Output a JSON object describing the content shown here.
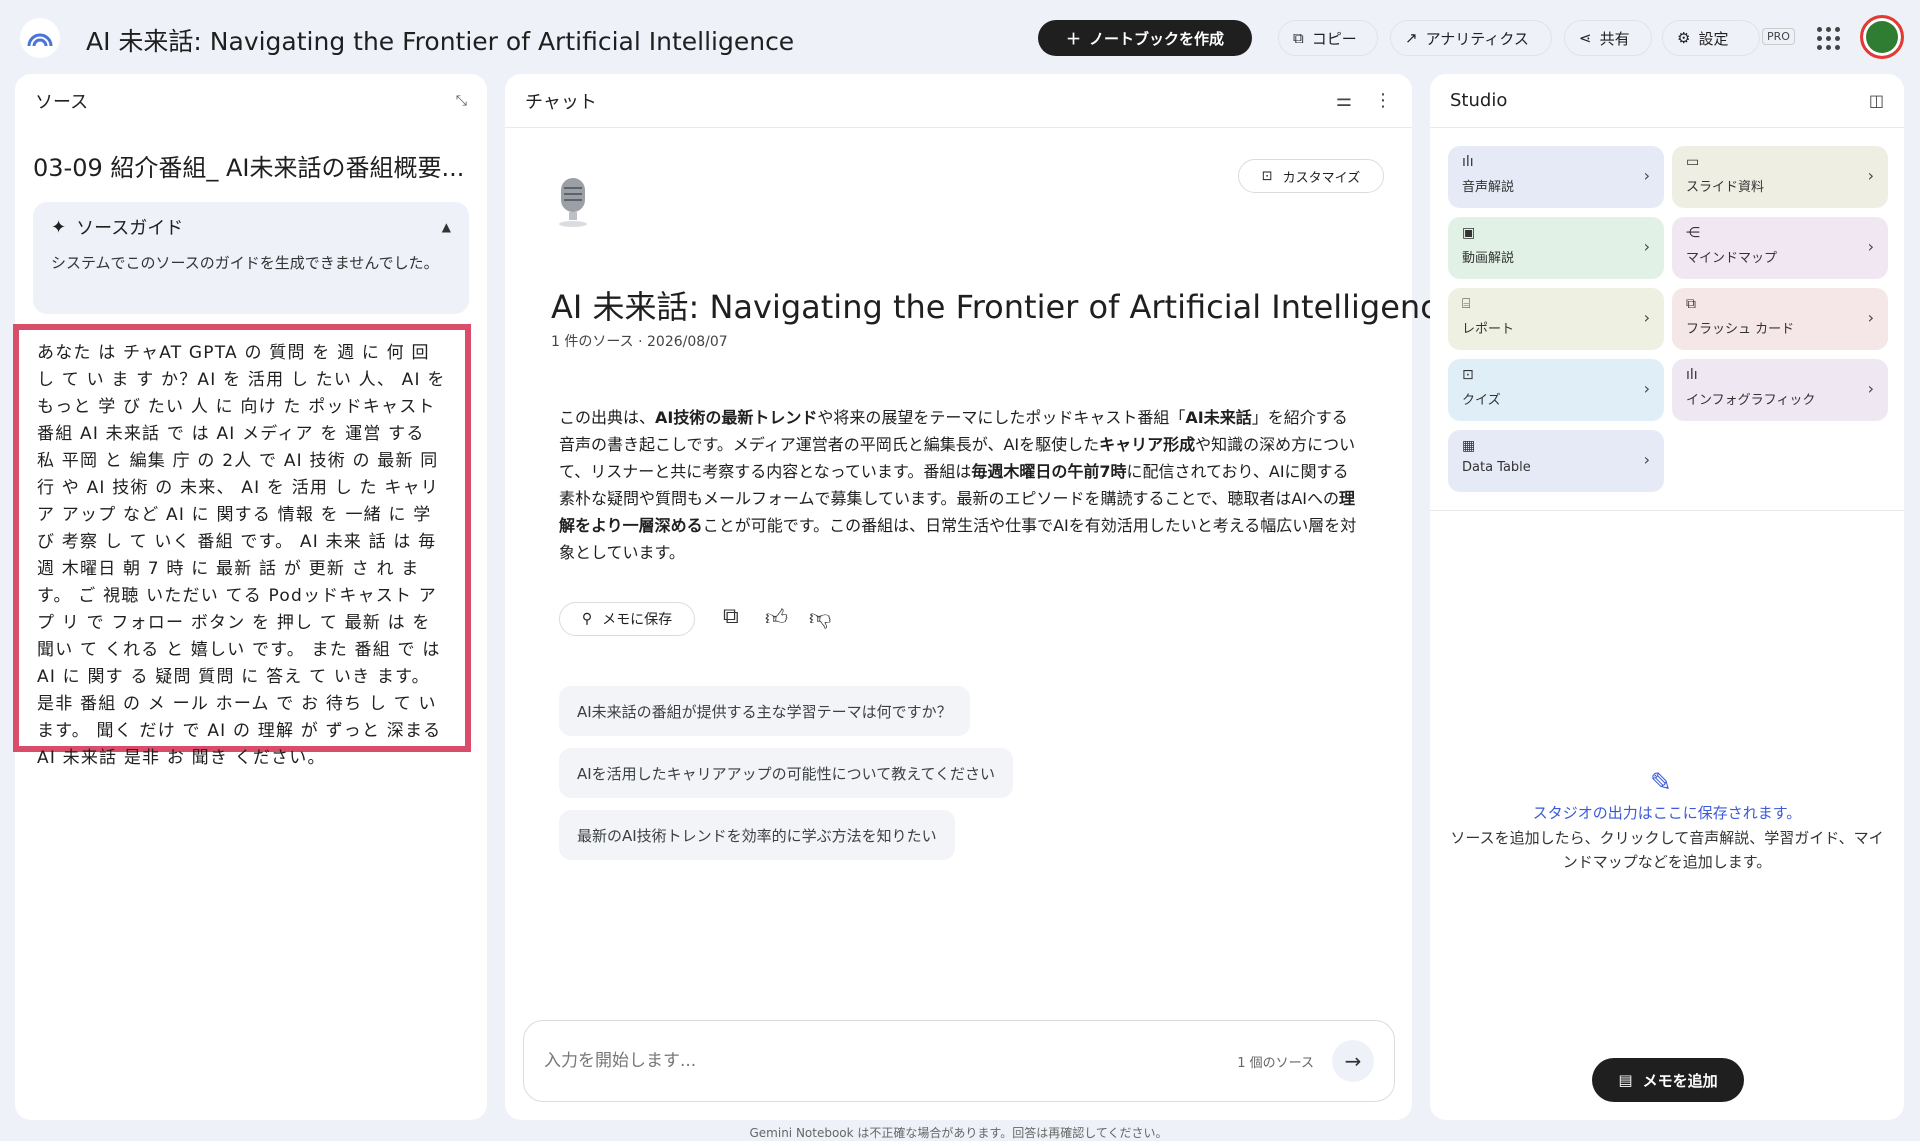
{
  "header": {
    "title": "AI 未来話: Navigating the Frontier of Artificial Intelligence",
    "create_label": "ノートブックを作成",
    "copy_label": "コピー",
    "analytics_label": "アナリティクス",
    "share_label": "共有",
    "settings_label": "設定",
    "pro_label": "PRO"
  },
  "sources": {
    "panel_title": "ソース",
    "source_title": "03-09 紹介番組_ AI未来話の番組概要...",
    "guide_title": "ソースガイド",
    "guide_text": "システムでこのソースのガイドを生成できませんでした。",
    "transcript": "あなた は チャAT GPTA の 質問 を 週 に 何 回 し て い ま す か？AI を 活用 し たい 人、 AI を もっと 学 び たい 人 に 向け た ポッドキャスト 番組 AI 未来話 で は AI メディア を 運営 する 私 平岡 と 編集 庁 の 2人 で AI 技術 の 最新 同行 や AI 技術 の 未来、 AI を 活用 し た キャリア アップ など AI に 関する 情報 を 一緒 に 学び 考察 し て いく 番組 です。 AI 未来 話 は 毎週 木曜日 朝 7 時 に 最新 話 が 更新 さ れ ま す。 ご 視聴 いただい てる Podッドキャスト アプ リ で フォロー ボタン を 押し て 最新 は を 聞い て くれる と 嬉しい です。 また 番組 で は AI に 関す る 疑問 質問 に 答え て いき ます。 是非 番組 の メ ール ホーム で お 待ち し て い ます。 聞く だけ で AI の 理解 が ずっと 深まる AI 未来話 是非 お 聞き ください。"
  },
  "chat": {
    "panel_title": "チャット",
    "customize_label": "カスタマイズ",
    "notebook_title": "AI 未来話: Navigating the Frontier of Artificial Intelligence",
    "meta": "1 件のソース · 2026/08/07",
    "summary": {
      "p1": "この出典は、",
      "b1": "AI技術の最新トレンド",
      "p2": "や将来の展望をテーマにしたポッドキャスト番組「",
      "b2": "AI未来話",
      "p3": "」を紹介する音声の書き起こしです。メディア運営者の平岡氏と編集長が、AIを駆使した",
      "b3": "キャリア形成",
      "p4": "や知識の深め方について、リスナーと共に考察する内容となっています。番組は",
      "b4": "毎週木曜日の午前7時",
      "p5": "に配信されており、AIに関する素朴な疑問や質問もメールフォームで募集しています。最新のエピソードを購読することで、聴取者はAIへの",
      "b5": "理解をより一層深める",
      "p6": "ことが可能です。この番組は、日常生活や仕事でAIを有効活用したいと考える幅広い層を対象としています。"
    },
    "save_memo_label": "メモに保存",
    "suggestions": [
      "AI未来話の番組が提供する主な学習テーマは何ですか？",
      "AIを活用したキャリアアップの可能性について教えてください",
      "最新のAI技術トレンドを効率的に学ぶ方法を知りたい"
    ],
    "input_placeholder": "入力を開始します...",
    "source_count": "1 個のソース",
    "footer_note": "Gemini Notebook は不正確な場合があります。回答は再確認してください。"
  },
  "studio": {
    "panel_title": "Studio",
    "tiles": [
      {
        "label": "音声解説",
        "color": "#e6eaf7",
        "icon": "audio-icon"
      },
      {
        "label": "スライド資料",
        "color": "#eeefe2",
        "icon": "slides-icon"
      },
      {
        "label": "動画解説",
        "color": "#e2f1e6",
        "icon": "video-icon"
      },
      {
        "label": "マインドマップ",
        "color": "#f1e7f2",
        "icon": "mindmap-icon"
      },
      {
        "label": "レポート",
        "color": "#eef0e2",
        "icon": "report-icon"
      },
      {
        "label": "フラッシュ カード",
        "color": "#f5e6e8",
        "icon": "flashcard-icon"
      },
      {
        "label": "クイズ",
        "color": "#e0eff7",
        "icon": "quiz-icon"
      },
      {
        "label": "インフォグラフィック",
        "color": "#efe7f2",
        "icon": "infographic-icon"
      },
      {
        "label": "Data Table",
        "color": "#e6eaf7",
        "icon": "table-icon"
      }
    ],
    "hint_title": "スタジオの出力はここに保存されます。",
    "hint_body": "ソースを追加したら、クリックして音声解説、学習ガイド、マインドマップなどを追加します。",
    "add_memo_label": "メモを追加"
  }
}
